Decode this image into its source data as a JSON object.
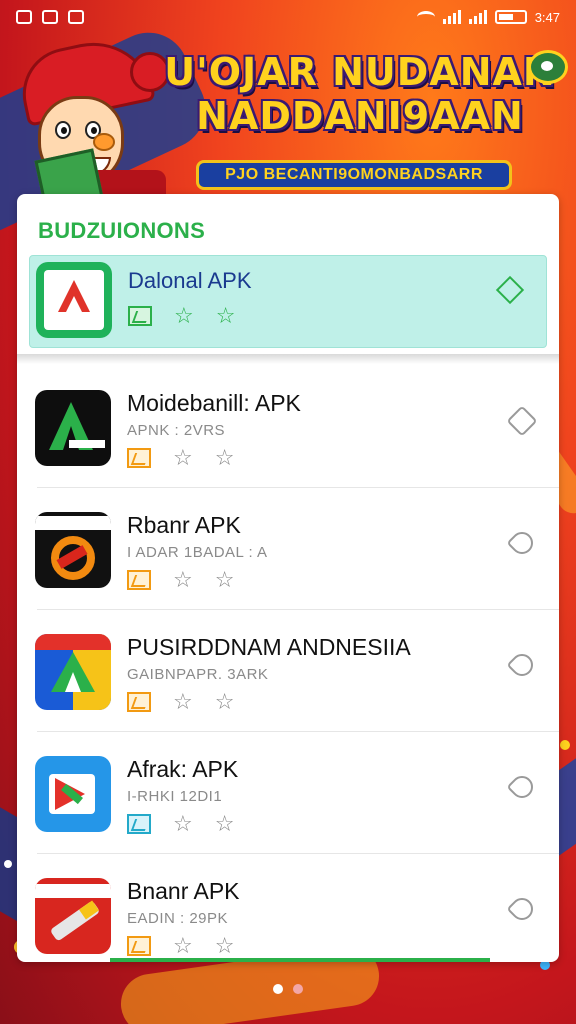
{
  "status_bar": {
    "time": "3:47"
  },
  "banner": {
    "title_line1": "U'OJAR NUDANAN",
    "title_line2": "NADDANI9AAN",
    "subtitle": "PJO BECANTI9OMONBADSARR"
  },
  "section": {
    "title": "BUDZUIONONS"
  },
  "featured": {
    "name": "Dalonal APK"
  },
  "apps": [
    {
      "name": "Moidebanill: APK",
      "sub": "APNK : 2VRS",
      "badge_color": "orange",
      "icon": "dark-a-icon"
    },
    {
      "name": "Rbanr APK",
      "sub": "I ADAR 1BADAL : A",
      "badge_color": "orange",
      "icon": "sticker-icon"
    },
    {
      "name": "PUSIRDDNAM ANDNESIIA",
      "sub": "GAIBNPAPR. 3ARK",
      "badge_color": "orange",
      "icon": "colorful-a-icon"
    },
    {
      "name": "Afrak: APK",
      "sub": "I-RHKI 12DI1",
      "badge_color": "teal",
      "icon": "blue-flag-icon"
    },
    {
      "name": "Bnanr APK",
      "sub": "EADIN : 29PK",
      "badge_color": "orange",
      "icon": "red-tool-icon"
    }
  ],
  "pager": {
    "pages": 2,
    "current": 1
  }
}
